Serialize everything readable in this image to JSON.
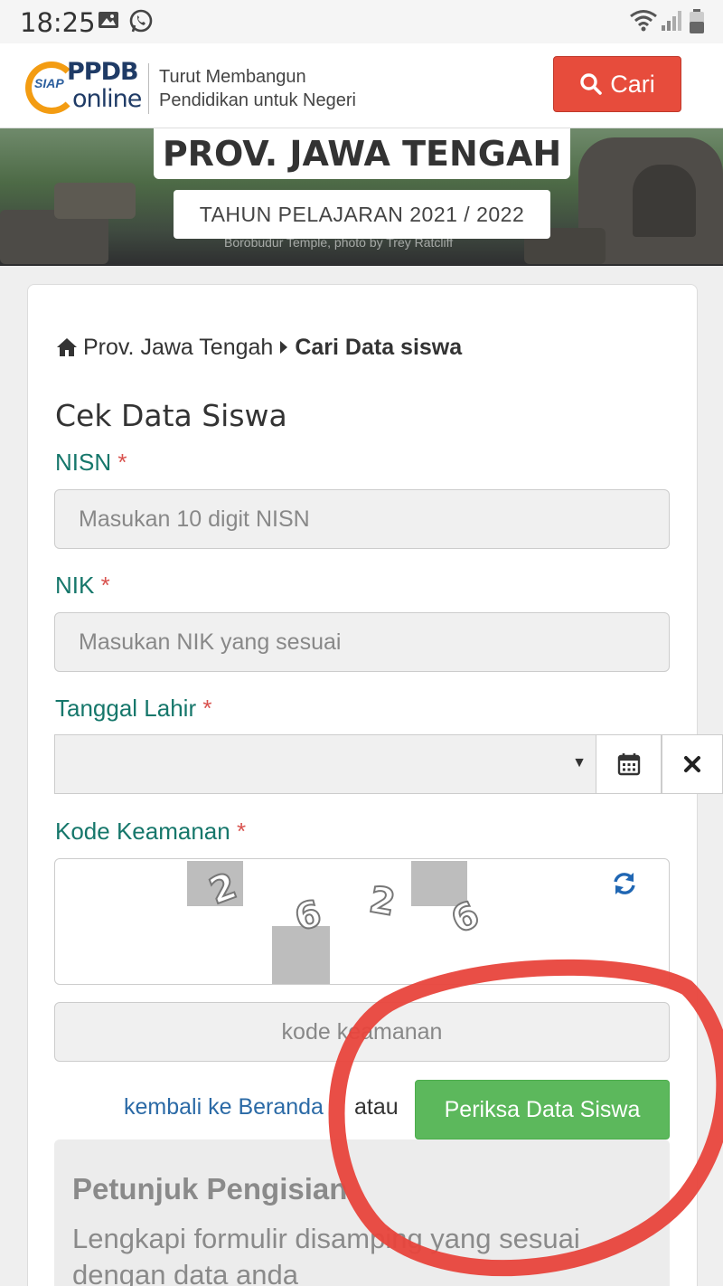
{
  "status_bar": {
    "time": "18:25"
  },
  "header": {
    "logo_sub": "SIAP",
    "logo_ppdb": "PPDB",
    "logo_online": "online",
    "tagline_line1": "Turut Membangun",
    "tagline_line2": "Pendidikan untuk Negeri",
    "search_button": "Cari"
  },
  "hero": {
    "title": "PROV. JAWA TENGAH",
    "year": "TAHUN PELAJARAN 2021 / 2022",
    "photo_credit": "Borobudur Temple, photo by Trey Ratcliff"
  },
  "breadcrumb": {
    "home": "Prov. Jawa Tengah",
    "current": "Cari Data siswa"
  },
  "form": {
    "title": "Cek Data Siswa",
    "required_mark": "*",
    "nisn_label": "NISN",
    "nisn_placeholder": "Masukan 10 digit NISN",
    "nik_label": "NIK",
    "nik_placeholder": "Masukan NIK yang sesuai",
    "dob_label": "Tanggal Lahir",
    "dob_value": "",
    "captcha_label": "Kode Keamanan",
    "captcha_chars": [
      "2",
      "6",
      "2",
      "6"
    ],
    "captcha_placeholder": "kode keamanan",
    "back_link": "kembali ke Beranda",
    "or_text": "atau",
    "submit_button": "Periksa Data Siswa"
  },
  "hint": {
    "title": "Petunjuk Pengisian",
    "text": "Lengkapi formulir disamping yang sesuai dengan data anda"
  },
  "icons": {
    "home": "home-icon",
    "caret": "caret-right-icon",
    "calendar": "calendar-icon",
    "clear": "close-icon",
    "refresh": "refresh-icon",
    "search": "search-icon"
  },
  "colors": {
    "primary_red": "#e74c3c",
    "success_green": "#5cb85c",
    "label_teal": "#16776b",
    "link_blue": "#2b6aa6",
    "annotation_red": "#e8453c"
  }
}
